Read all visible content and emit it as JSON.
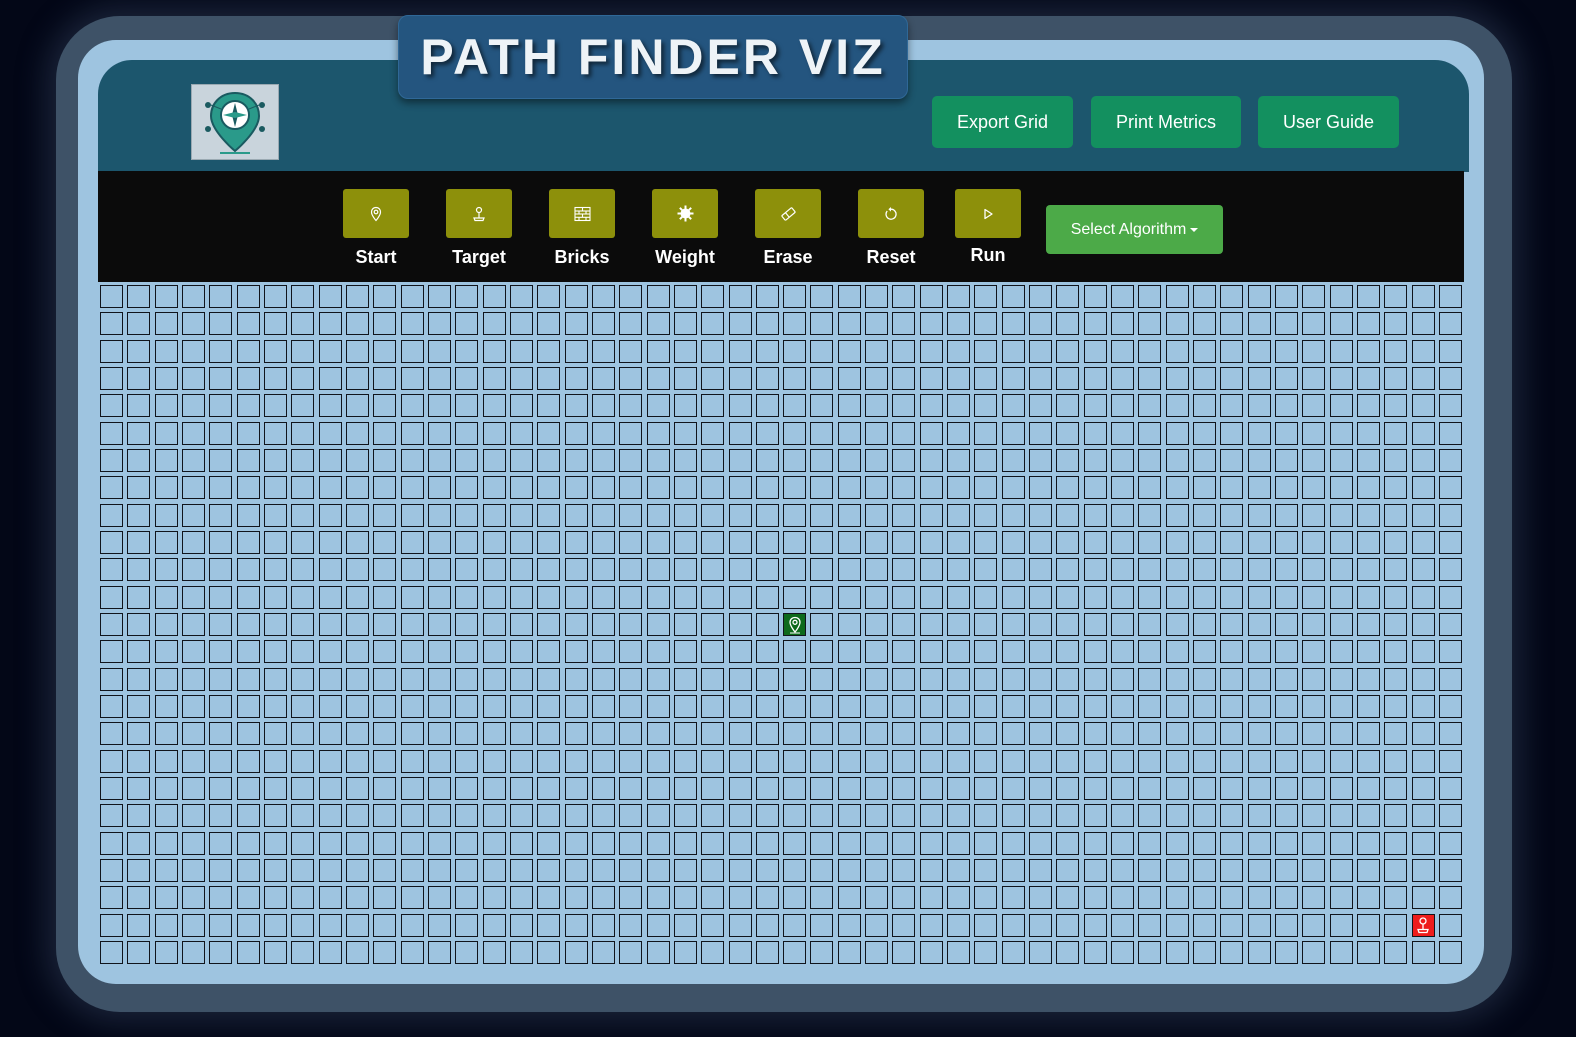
{
  "app": {
    "title": "PATH FINDER VIZ"
  },
  "header": {
    "buttons": {
      "export": "Export Grid",
      "print": "Print Metrics",
      "guide": "User Guide"
    }
  },
  "toolbar": {
    "tools": {
      "start": "Start",
      "target": "Target",
      "bricks": "Bricks",
      "weight": "Weight",
      "erase": "Erase",
      "reset": "Reset",
      "run": "Run"
    },
    "algorithm_dropdown": "Select Algorithm"
  },
  "grid": {
    "rows": 25,
    "cols": 50,
    "start": {
      "row": 12,
      "col": 25
    },
    "target": {
      "row": 23,
      "col": 48
    }
  },
  "colors": {
    "header": "#1c566d",
    "title_box": "#24557f",
    "header_button": "#13905f",
    "tool_button": "#8d900b",
    "algorithm_button": "#4caa48",
    "cell": "#9ec4e0",
    "start_cell": "#0e6a1c",
    "target_cell": "#ee1c1c"
  },
  "icons": {
    "logo": "compass-map-pin-logo",
    "start": "map-pin-icon",
    "target": "joystick-icon",
    "bricks": "brick-wall-icon",
    "weight": "gear-icon",
    "erase": "eraser-icon",
    "reset": "reset-icon",
    "run": "play-icon"
  }
}
